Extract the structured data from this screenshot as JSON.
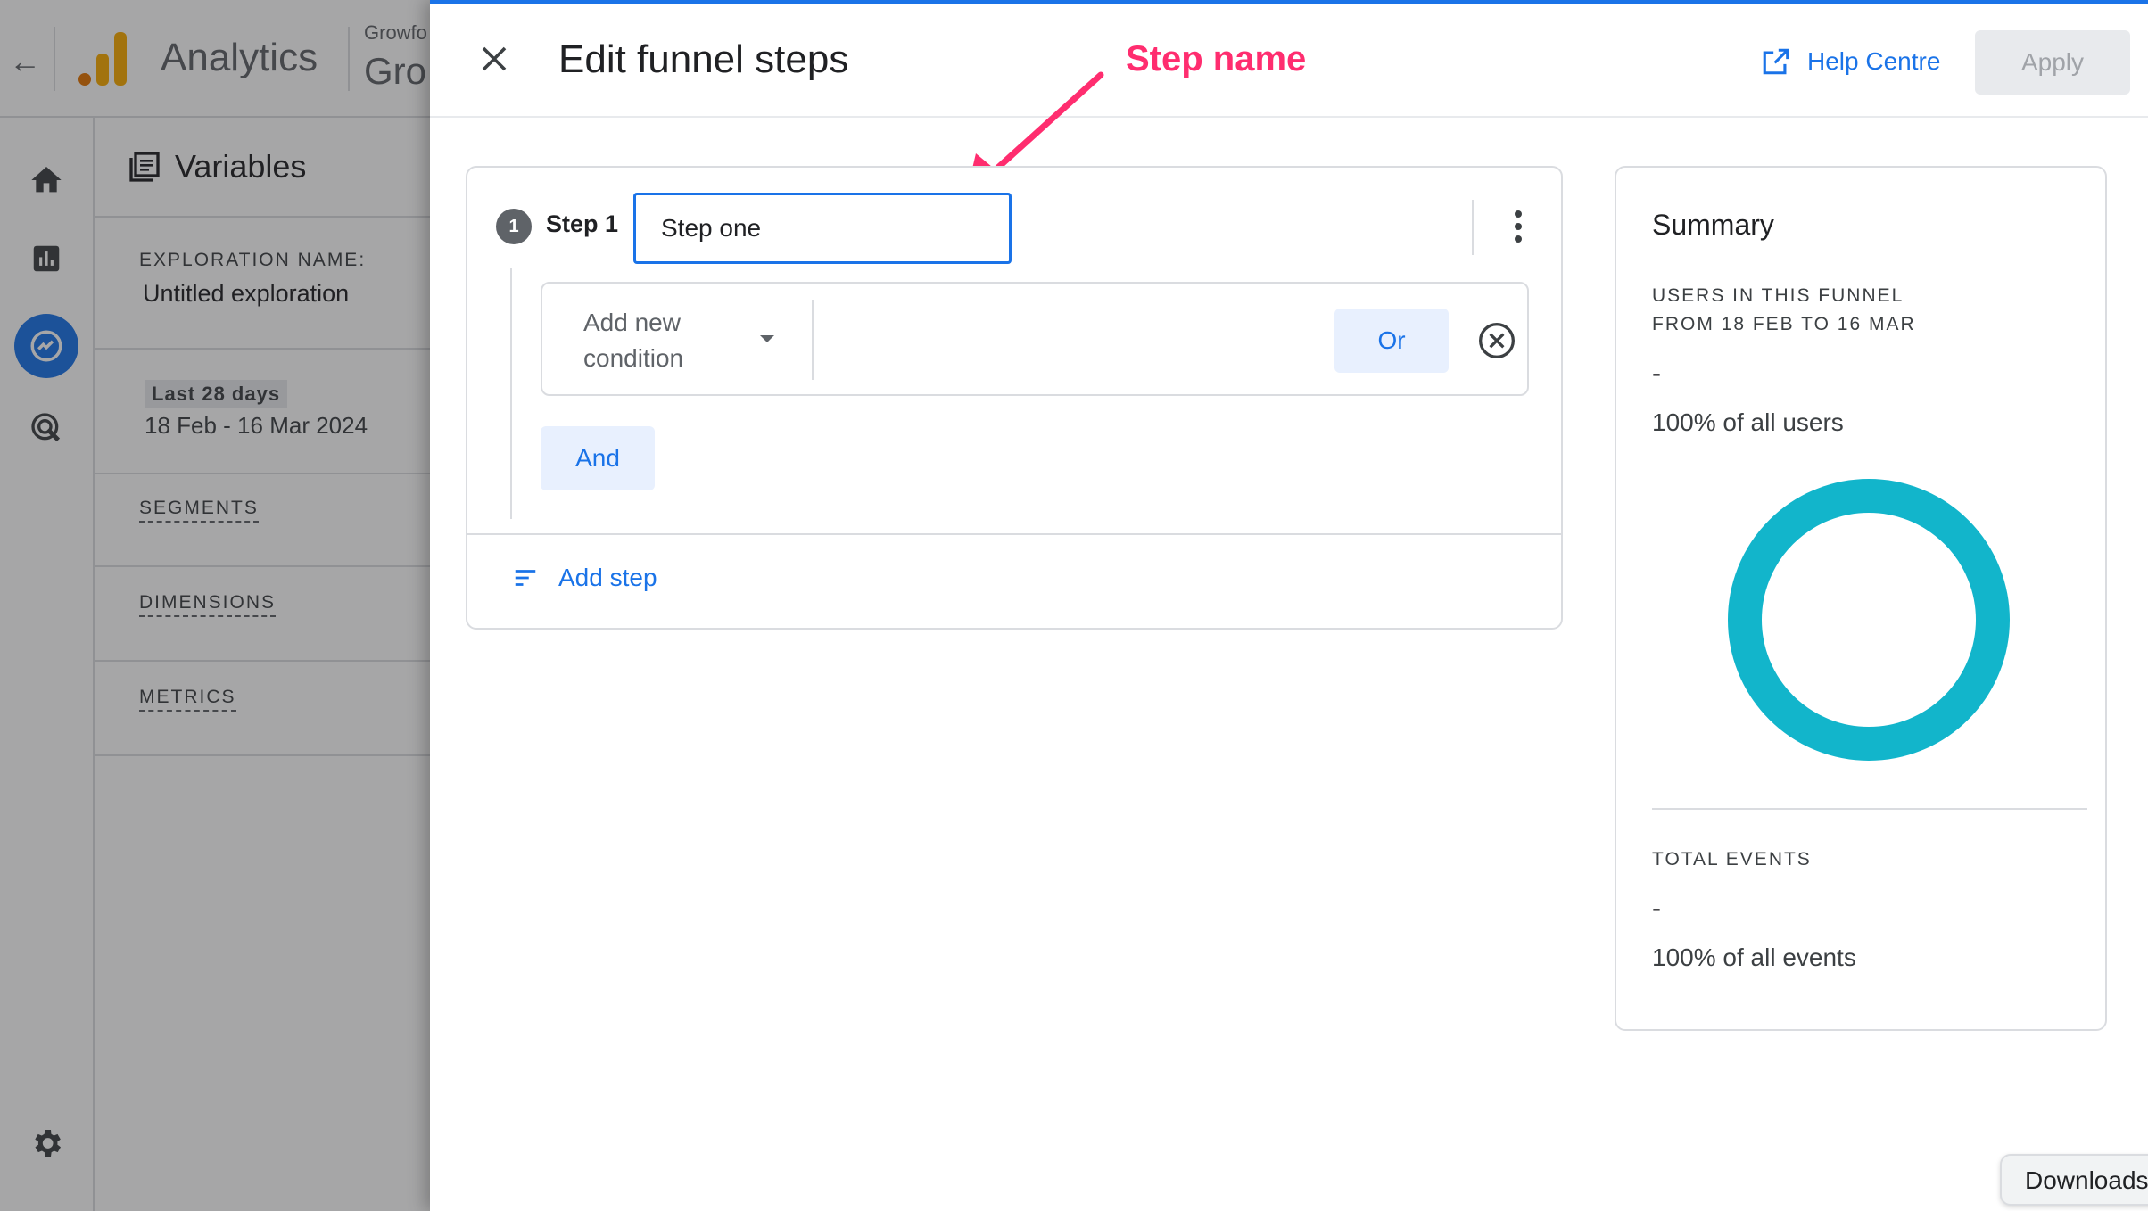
{
  "app": {
    "title": "Analytics",
    "account_small": "Growfo",
    "account_big": "Gro"
  },
  "variables": {
    "heading": "Variables",
    "exploration_label": "EXPLORATION NAME:",
    "exploration_value": "Untitled exploration",
    "date_chip": "Last 28 days",
    "date_range": "18 Feb - 16 Mar 2024",
    "sections": [
      "SEGMENTS",
      "DIMENSIONS",
      "METRICS"
    ]
  },
  "drawer": {
    "title": "Edit funnel steps",
    "help_label": "Help Centre",
    "apply_label": "Apply"
  },
  "annotation": {
    "text": "Step name",
    "color": "#ff2d6f"
  },
  "step": {
    "number": "1",
    "label": "Step 1",
    "name_value": "Step one",
    "condition_placeholder": "Add new condition",
    "or_label": "Or",
    "and_label": "And",
    "add_step_label": "Add step"
  },
  "summary": {
    "title": "Summary",
    "users_label": "USERS IN THIS FUNNEL FROM 18 FEB TO 16 MAR",
    "users_value": "-",
    "users_pct": "100% of all users",
    "events_label": "TOTAL EVENTS",
    "events_value": "-",
    "events_pct": "100% of all events",
    "donut_color": "#12b5cb"
  },
  "browser": {
    "downloads_label": "Downloads"
  },
  "colors": {
    "accent": "#1a73e8",
    "ga_orange": "#f9ab00"
  }
}
